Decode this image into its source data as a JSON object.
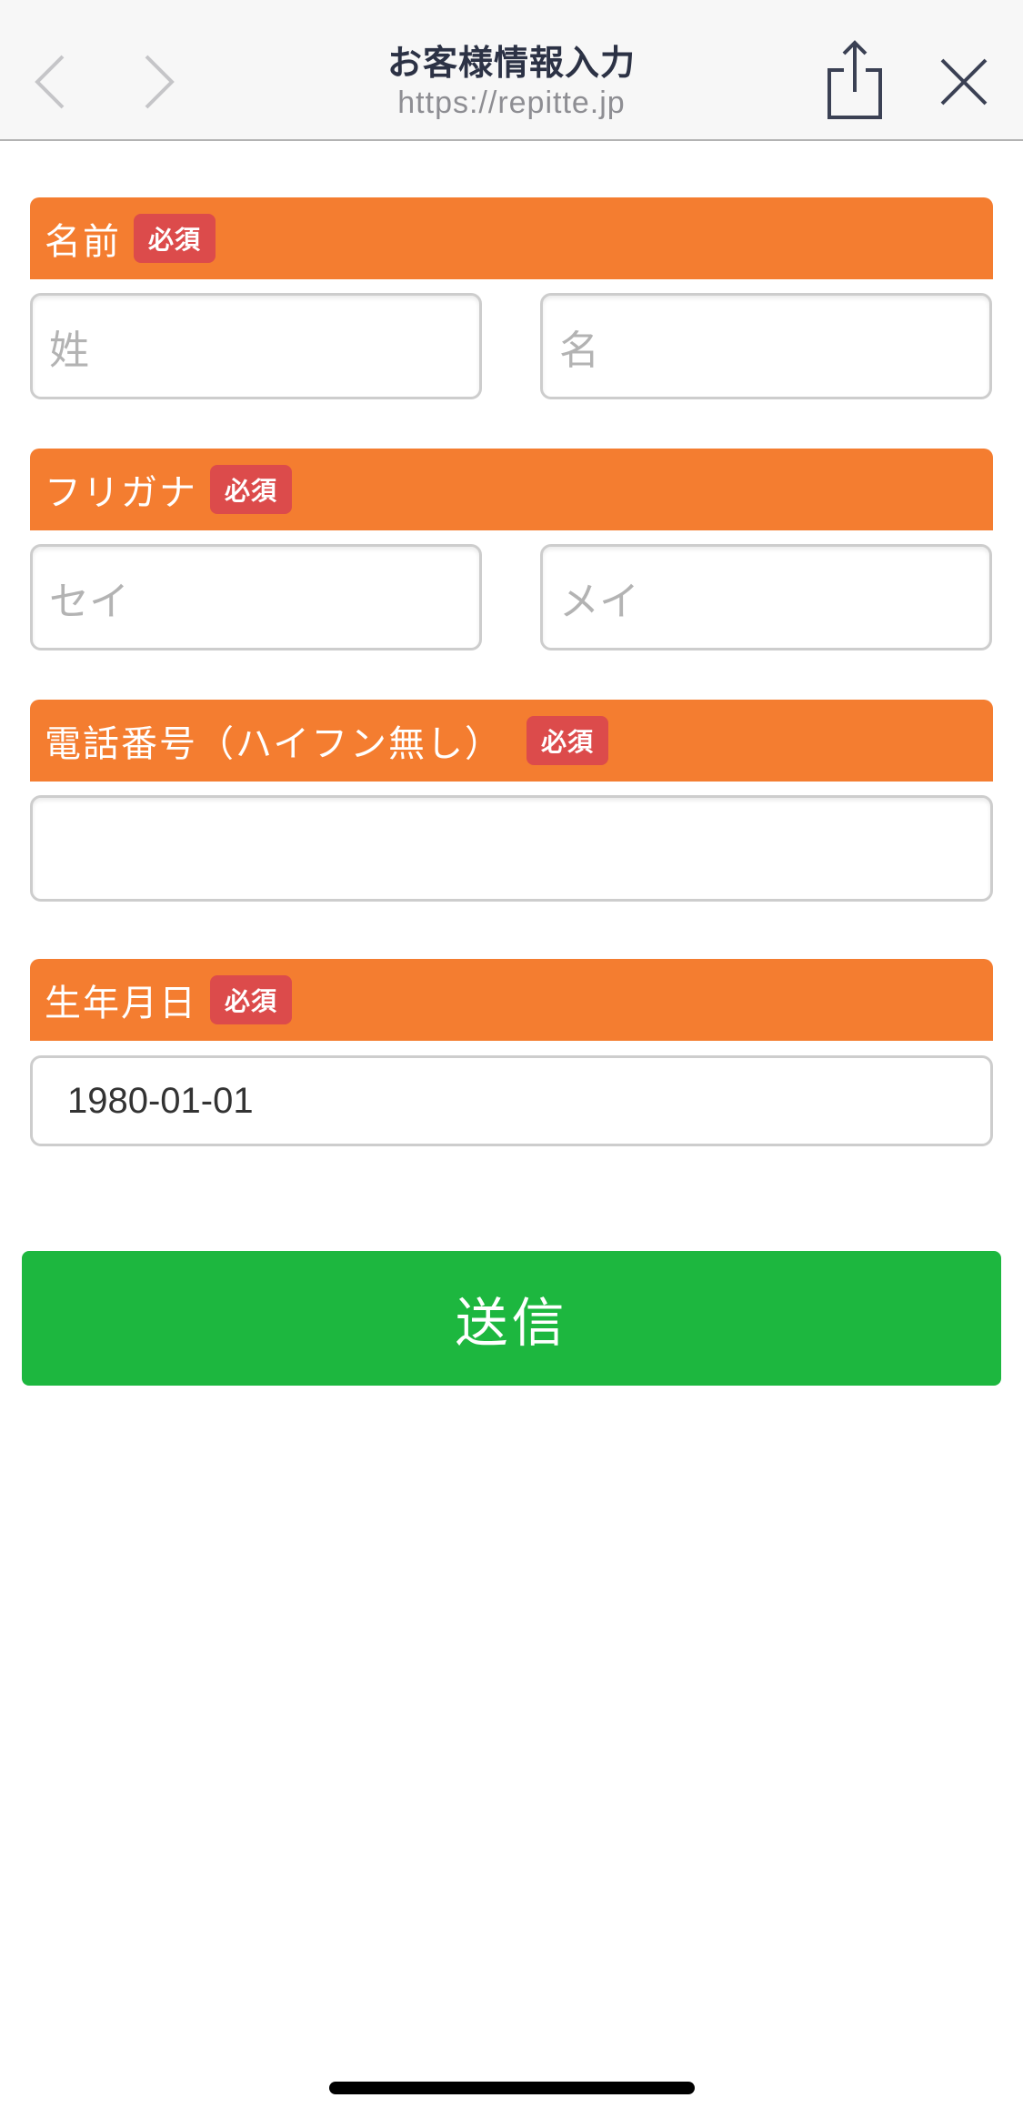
{
  "browser": {
    "title": "お客様情報入力",
    "url": "https://repitte.jp"
  },
  "form": {
    "name": {
      "label": "名前",
      "required_badge": "必須",
      "last_placeholder": "姓",
      "first_placeholder": "名"
    },
    "furigana": {
      "label": "フリガナ",
      "required_badge": "必須",
      "last_placeholder": "セイ",
      "first_placeholder": "メイ"
    },
    "phone": {
      "label": "電話番号（ハイフン無し）",
      "required_badge": "必須",
      "value": ""
    },
    "birthdate": {
      "label": "生年月日",
      "required_badge": "必須",
      "value": "1980-01-01"
    },
    "submit_label": "送信"
  },
  "colors": {
    "section_header": "#f47d30",
    "required_badge": "#dc4b4b",
    "submit_button": "#1db73f"
  },
  "icons": {
    "back": "chevron-left-icon",
    "forward": "chevron-right-icon",
    "share": "share-icon",
    "close": "close-icon"
  }
}
